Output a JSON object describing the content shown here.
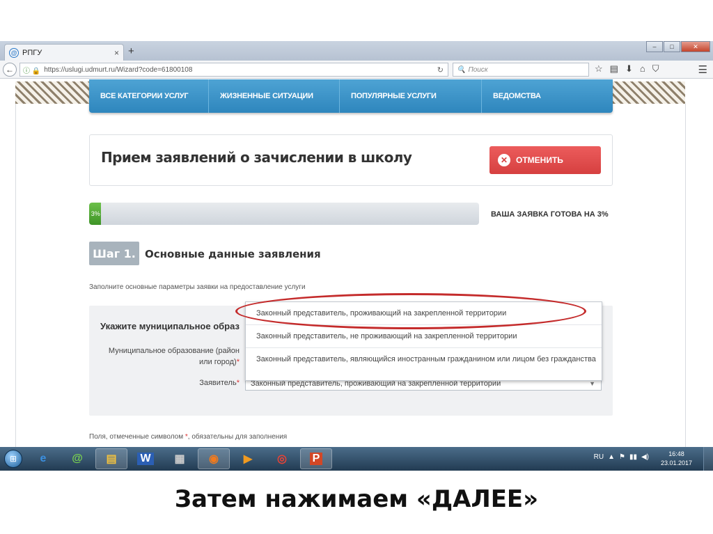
{
  "browser": {
    "tab_title": "РПГУ",
    "tab_close": "×",
    "new_tab": "+",
    "url": "https://uslugi.udmurt.ru/Wizard?code=61800108",
    "search_placeholder": "Поиск"
  },
  "site_nav": {
    "items": [
      {
        "label": "ВСЕ КАТЕГОРИИ УСЛУГ"
      },
      {
        "label": "ЖИЗНЕННЫЕ СИТУАЦИИ"
      },
      {
        "label": "ПОПУЛЯРНЫЕ УСЛУГИ"
      },
      {
        "label": "ВЕДОМСТВА"
      }
    ]
  },
  "service": {
    "title": "Прием заявлений о зачислении в школу",
    "cancel_label": "ОТМЕНИТЬ"
  },
  "progress": {
    "percent_label": "3%",
    "value": 3,
    "status_text": "ВАША ЗАЯВКА ГОТОВА НА 3%"
  },
  "step": {
    "badge": "Шаг 1.",
    "title": "Основные данные заявления",
    "hint": "Заполните основные параметры заявки на предоставление услуги"
  },
  "form": {
    "section_title": "Укажите муниципальное образ",
    "municipality_label": "Муниципальное образование (район или город)",
    "applicant_label": "Заявитель",
    "required_mark": "*",
    "applicant_value": "Законный представитель, проживающий на закрепленной территории"
  },
  "dropdown": {
    "options": [
      {
        "label": "Законный представитель, проживающий на закрепленной территории"
      },
      {
        "label": "Законный представитель, не проживающий на закрепленной территории"
      },
      {
        "label": "Законный представитель, являющийся иностранным гражданином или лицом без гражданства"
      }
    ]
  },
  "footnote": {
    "before": "Поля, отмеченные символом ",
    "mark": "*",
    "after": ", обязательны для заполнения"
  },
  "taskbar": {
    "lang": "RU",
    "time": "16:48",
    "date": "23.01.2017"
  },
  "caption": "Затем нажимаем «ДАЛЕЕ»",
  "colors": {
    "nav_blue": "#2e86bd",
    "cancel_red": "#d64040",
    "progress_green": "#3e9427",
    "highlight": "#c42b2b"
  }
}
